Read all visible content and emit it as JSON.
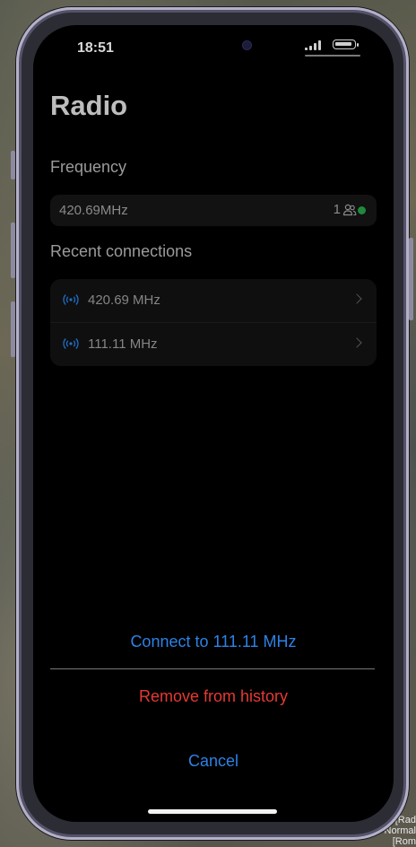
{
  "status_bar": {
    "time": "18:51"
  },
  "page": {
    "title": "Radio"
  },
  "frequency": {
    "label": "Frequency",
    "value": "420.69MHz",
    "users_count": "1",
    "online_color": "#1f8a3c"
  },
  "recent": {
    "label": "Recent connections",
    "items": [
      {
        "label": "420.69 MHz"
      },
      {
        "label": "111.11 MHz"
      }
    ]
  },
  "action_sheet": {
    "connect_label": "Connect to 111.11 MHz",
    "remove_label": "Remove from history",
    "cancel_label": "Cancel",
    "accent_color": "#2d82e6",
    "destructive_color": "#e53935"
  },
  "background_overlay": {
    "text": "hz [Rad Normal [Rom"
  }
}
